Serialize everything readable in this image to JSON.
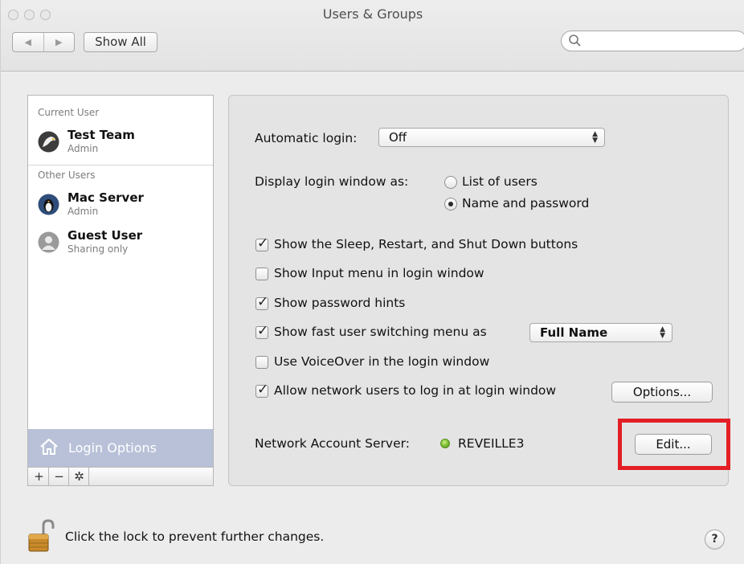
{
  "window": {
    "title": "Users & Groups"
  },
  "toolbar": {
    "back_glyph": "◀",
    "forward_glyph": "▶",
    "show_all_label": "Show All",
    "search_placeholder": ""
  },
  "sidebar": {
    "current_user_header": "Current User",
    "current_user": {
      "name": "Test Team",
      "role": "Admin",
      "avatar_icon": "eagle-icon"
    },
    "other_users_header": "Other Users",
    "other_users": [
      {
        "name": "Mac Server",
        "role": "Admin",
        "avatar_icon": "penguin-icon"
      },
      {
        "name": "Guest User",
        "role": "Sharing only",
        "avatar_icon": "user-silhouette-icon"
      }
    ],
    "login_options_label": "Login Options",
    "add_glyph": "+",
    "remove_glyph": "−",
    "gear_glyph": "✲"
  },
  "options": {
    "automatic_login_label": "Automatic login:",
    "automatic_login_value": "Off",
    "display_login_as_label": "Display login window as:",
    "radio_list_label": "List of users",
    "radio_name_label": "Name and password",
    "radio_selected": "Name and password",
    "checks": [
      {
        "label": "Show the Sleep, Restart, and Shut Down buttons",
        "checked": true
      },
      {
        "label": "Show Input menu in login window",
        "checked": false
      },
      {
        "label": "Show password hints",
        "checked": true
      },
      {
        "label": "Show fast user switching menu as",
        "checked": true
      },
      {
        "label": "Use VoiceOver in the login window",
        "checked": false
      },
      {
        "label": "Allow network users to log in at login window",
        "checked": true
      }
    ],
    "fast_switch_value": "Full Name",
    "options_button_label": "Options...",
    "network_server_label": "Network Account Server:",
    "network_server_value": "REVEILLE3",
    "edit_button_label": "Edit...",
    "status_color": "#6fb52c",
    "highlight_color": "#e31e24"
  },
  "footer": {
    "lock_text": "Click the lock to prevent further changes.",
    "help_label": "?"
  }
}
